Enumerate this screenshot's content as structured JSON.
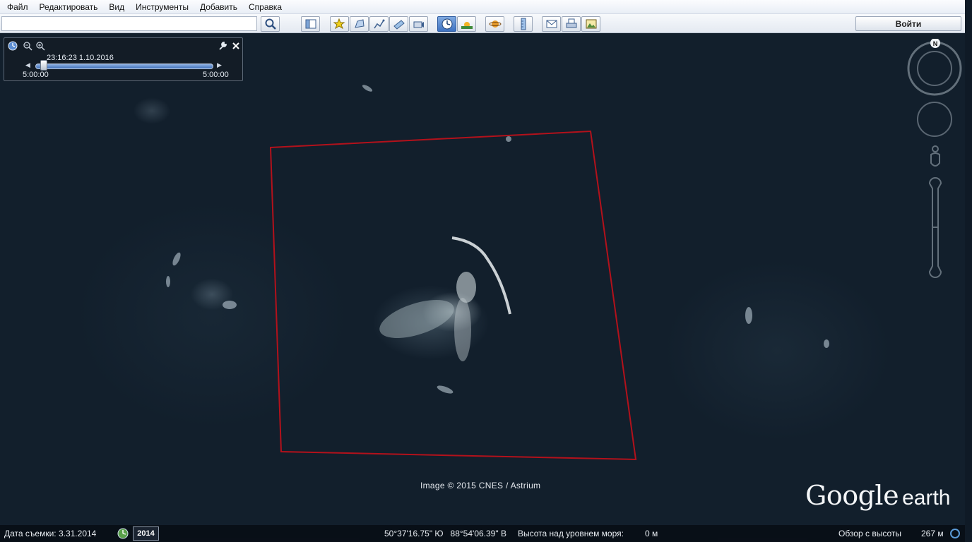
{
  "menu": {
    "items": [
      "Файл",
      "Редактировать",
      "Вид",
      "Инструменты",
      "Добавить",
      "Справка"
    ]
  },
  "toolbar": {
    "search_value": "",
    "login_label": "Войти",
    "buttons": [
      "sidebar-icon",
      "placemark-icon",
      "polygon-icon",
      "path-icon",
      "image-overlay-icon",
      "record-tour-icon",
      "historical-imagery-icon",
      "sunlight-icon",
      "planets-icon",
      "ruler-icon",
      "email-icon",
      "print-icon",
      "save-image-icon"
    ],
    "active_button": "historical-imagery-icon"
  },
  "time_slider": {
    "current_time": "23:16:23 1.10.2016",
    "start_label": "5:00:00",
    "end_label": "5:00:00",
    "position_fraction": 0.03
  },
  "map": {
    "copyright": "Image © 2015 CNES / Astrium",
    "logo_google": "Google",
    "logo_earth": "earth",
    "polygon_color": "#b3111b",
    "north_label": "N"
  },
  "status": {
    "capture_date": "Дата съемки: 3.31.2014",
    "year": "2014",
    "coordinates": "50°37'16.75\" Ю   88°54'06.39\" В",
    "elevation_label": "Высота над уровнем моря:",
    "elevation_value": "0 м",
    "eye_alt_label": "Обзор с высоты",
    "eye_alt_value": "267 м"
  }
}
